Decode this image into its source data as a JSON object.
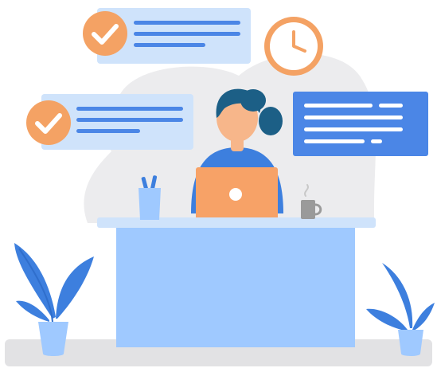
{
  "illustration": {
    "colors": {
      "blob": "#ececee",
      "card_light": "#cfe3fb",
      "card_blue": "#4b86e6",
      "line_blue": "#4b86e6",
      "line_white": "#ffffff",
      "check_circle": "#f4a264",
      "clock_face": "#ffffff",
      "clock_ring": "#f4a264",
      "person_hair": "#1c5f86",
      "person_skin": "#f7b68a",
      "shirt": "#3d7fde",
      "laptop": "#f7a267",
      "desk_top": "#cfe3fb",
      "desk_body": "#9fc9ff",
      "cup": "#9fc9ff",
      "pencils": "#3d7fde",
      "mug": "#9a9a9a",
      "plant_leaf": "#3d7fde",
      "pot": "#9fc9ff",
      "floor": "#e2e2e4"
    },
    "icons": [
      "check-icon",
      "check-icon",
      "clock-icon",
      "pencil-cup-icon",
      "coffee-mug-icon",
      "plant-icon",
      "plant-icon"
    ]
  }
}
